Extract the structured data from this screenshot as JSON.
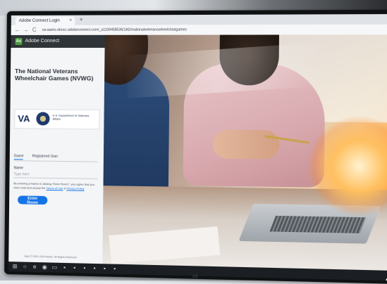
{
  "browser": {
    "tab_title": "Adobe Connect Login",
    "tab_close": "×",
    "new_tab": "+",
    "url": "va-wamc.ebncc.adobeconnect.com/_a1109458536/1AD/nationalveteranswheelchairgames",
    "nav_back": "←",
    "nav_forward": "→",
    "nav_reload": "C"
  },
  "panel": {
    "brand_name": "Adobe Connect",
    "brand_logo_glyph": "Ac",
    "meeting_title": "The National Veterans Wheelchair Games (NVWG)",
    "va_logo": {
      "letters": "VA",
      "dept": "U.S. Department of Veterans Affairs"
    },
    "tabs": [
      {
        "label": "Guest",
        "active": true
      },
      {
        "label": "Registered User",
        "active": false
      }
    ],
    "name_label": "Name",
    "name_placeholder": "Type here",
    "consent_prefix": "By entering a Name & clicking \"Enter Room\", you agree that you have read and accept the ",
    "terms_link": "Terms of Use",
    "consent_mid": " & ",
    "privacy_link": "Privacy Policy",
    "enter_button": "Enter Room",
    "copyright": "Help © 2001-2020 Adobe. All Rights Reserved."
  },
  "monitor": {
    "brand": "LG"
  },
  "colors": {
    "accent": "#1473e6",
    "brand_green": "#4a9c3e",
    "brand_bar": "#2f3438"
  }
}
